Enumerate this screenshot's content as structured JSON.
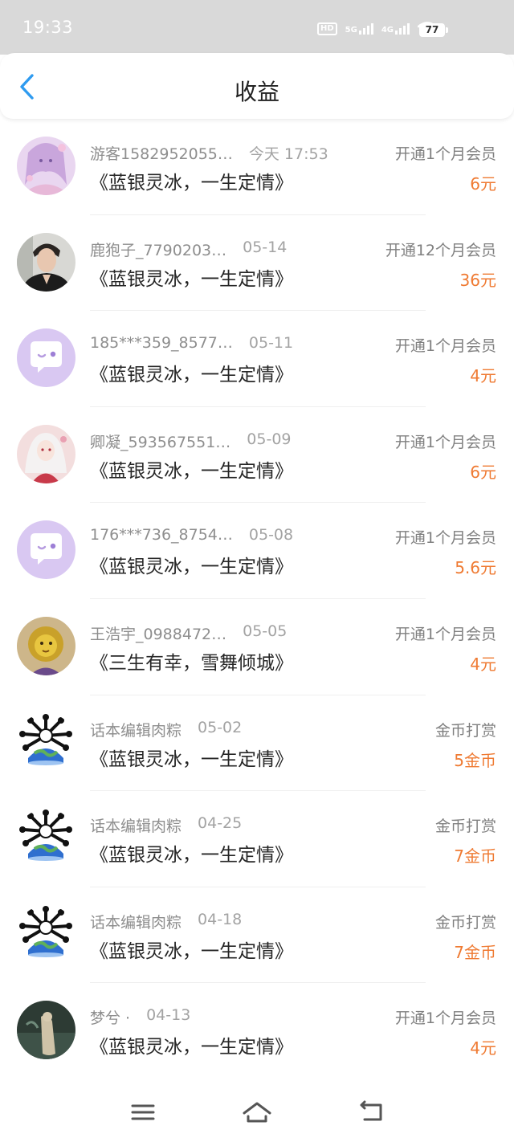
{
  "status_bar": {
    "time": "19:33",
    "network_hd": "HD",
    "network_5g": "5G",
    "network_4g": "4G",
    "battery": "77"
  },
  "header": {
    "title": "收益",
    "back_icon": "chevron-left-icon"
  },
  "colors": {
    "accent": "#2f9bf0",
    "amount": "#ef7a32"
  },
  "records": [
    {
      "user": "游客1582952055…",
      "date": "今天 17:53",
      "title": "《蓝银灵冰，一生定情》",
      "type": "开通1个月会员",
      "amount": "6元",
      "avatar": "anime-girl-pink"
    },
    {
      "user": "鹿狍子_7790203…",
      "date": "05-14",
      "title": "《蓝银灵冰，一生定情》",
      "type": "开通12个月会员",
      "amount": "36元",
      "avatar": "photo-young-man"
    },
    {
      "user": "185***359_8577…",
      "date": "05-11",
      "title": "《蓝银灵冰，一生定情》",
      "type": "开通1个月会员",
      "amount": "4元",
      "avatar": "default-chat-bubble"
    },
    {
      "user": "卿凝_593567551…",
      "date": "05-09",
      "title": "《蓝银灵冰，一生定情》",
      "type": "开通1个月会员",
      "amount": "6元",
      "avatar": "anime-girl-white-hair"
    },
    {
      "user": "176***736_8754…",
      "date": "05-08",
      "title": "《蓝银灵冰，一生定情》",
      "type": "开通1个月会员",
      "amount": "5.6元",
      "avatar": "default-chat-bubble"
    },
    {
      "user": "王浩宇_0988472…",
      "date": "05-05",
      "title": "《三生有幸，雪舞倾城》",
      "type": "开通1个月会员",
      "amount": "4元",
      "avatar": "golden-lion-figure"
    },
    {
      "user": "话本编辑肉粽",
      "date": "05-02",
      "title": "《蓝银灵冰，一生定情》",
      "type": "金币打赏",
      "amount": "5金币",
      "avatar": "earth-creature"
    },
    {
      "user": "话本编辑肉粽",
      "date": "04-25",
      "title": "《蓝银灵冰，一生定情》",
      "type": "金币打赏",
      "amount": "7金币",
      "avatar": "earth-creature"
    },
    {
      "user": "话本编辑肉粽",
      "date": "04-18",
      "title": "《蓝银灵冰，一生定情》",
      "type": "金币打赏",
      "amount": "7金币",
      "avatar": "earth-creature"
    },
    {
      "user": "梦兮 ·",
      "date": "04-13",
      "title": "《蓝银灵冰，一生定情》",
      "type": "开通1个月会员",
      "amount": "4元",
      "avatar": "dark-painting-figure"
    }
  ],
  "nav": {
    "menu_icon": "menu-icon",
    "home_icon": "home-icon",
    "back_icon": "back-icon"
  }
}
